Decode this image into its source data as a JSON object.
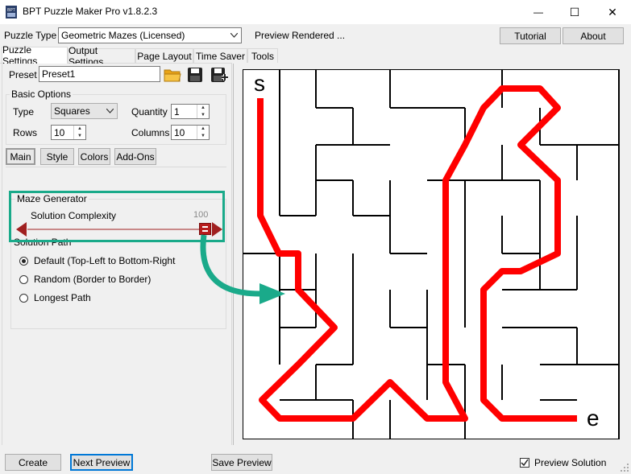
{
  "window": {
    "title": "BPT Puzzle Maker Pro v1.8.2.3",
    "minimize_glyph": "—",
    "maximize_glyph": "☐",
    "close_glyph": "✕"
  },
  "topbar": {
    "puzzle_type_label": "Puzzle Type",
    "puzzle_type_value": "Geometric Mazes (Licensed)",
    "status": "Preview Rendered ...",
    "tutorial_label": "Tutorial",
    "about_label": "About"
  },
  "tabs": [
    "Puzzle Settings",
    "Output Settings",
    "Page Layout",
    "Time Saver",
    "Tools"
  ],
  "preset": {
    "label": "Preset",
    "value": "Preset1"
  },
  "basic_options": {
    "legend": "Basic Options",
    "type_label": "Type",
    "type_value": "Squares",
    "quantity_label": "Quantity",
    "quantity_value": "1",
    "rows_label": "Rows",
    "rows_value": "10",
    "columns_label": "Columns",
    "columns_value": "10"
  },
  "subtabs": [
    "Main",
    "Style",
    "Colors",
    "Add-Ons"
  ],
  "maze_generator": {
    "legend": "Maze Generator",
    "complexity_label": "Solution Complexity",
    "complexity_value": "100",
    "complexity_fraction": 1.0,
    "solution_path_legend": "Solution Path",
    "options": [
      {
        "label": "Default (Top-Left to Bottom-Right",
        "selected": true
      },
      {
        "label": "Random (Border to Border)",
        "selected": false
      },
      {
        "label": "Longest Path",
        "selected": false
      }
    ]
  },
  "maze": {
    "start_label": "s",
    "end_label": "e",
    "solution_color": "#ff0000",
    "annotation_color": "#1aaa8a"
  },
  "bottom": {
    "create_label": "Create",
    "next_preview_label": "Next Preview",
    "save_preview_label": "Save Preview",
    "preview_solution_label": "Preview Solution",
    "preview_solution_checked": true
  }
}
